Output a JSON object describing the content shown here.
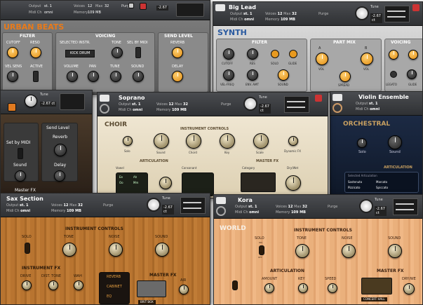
{
  "panels": {
    "urban": {
      "title": "URBAN BEATS",
      "sections": [
        "FILTER",
        "VOICING",
        "SEND LEVEL"
      ],
      "labels": [
        "CUTOFF",
        "RESO",
        "SELECTED INSTR.",
        "TONE",
        "SEL BY MIDI",
        "REVERB",
        "VEL SENS",
        "ACTIVE",
        "VOLUME",
        "PAN",
        "TUNE",
        "SOUND",
        "DELAY"
      ],
      "select": "KICK DRUM",
      "hdr": {
        "output": "Output",
        "output_val": "st. 1",
        "midi": "Midi Ch",
        "midi_val": "omni",
        "voices": "Voices",
        "voices_val": "12",
        "max": "Max",
        "max_val": "32",
        "memory": "Memory",
        "memory_val": "109 MB",
        "purge": "Purge",
        "tune_val": "-2.67"
      }
    },
    "synth": {
      "instrument": "Big Lead",
      "title": "SYNTH",
      "sections": [
        "FILTER",
        "PART MIX",
        "VOICING"
      ],
      "labels": [
        "CUTOFF",
        "RES",
        "SOLO",
        "GLIDE",
        "A",
        "B",
        "VOL",
        "VOL",
        "SPREAD",
        "VEL-FREQ",
        "ENV. AMT",
        "SOUND",
        "LEGATO",
        "GLIDE",
        "SPREAD"
      ],
      "hdr": {
        "output": "Output",
        "output_val": "st. 1",
        "midi": "Midi Ch",
        "midi_val": "omni",
        "voices": "Voices",
        "voices_val": "12",
        "max": "Max",
        "max_val": "32",
        "memory": "Memory",
        "memory_val": "109 MB",
        "purge": "Purge",
        "tune": "Tune",
        "tune_val": "-2.67 ct"
      }
    },
    "orange": {
      "sections": [
        "Send Level"
      ],
      "labels": [
        "Set by MIDI",
        "Reverb",
        "Sound",
        "Delay",
        "Master FX"
      ],
      "hdr": {
        "tune": "Tune",
        "tune_val": "-2.67 ct"
      }
    },
    "choir": {
      "instrument": "Soprano",
      "title": "CHOIR",
      "section": "INSTRUMENT CONTROLS",
      "knobs": [
        "Solo",
        "Sound",
        "Chord",
        "Key",
        "Scale",
        "Dynamic FX"
      ],
      "articulation": "ARTICULATION",
      "vowel": "Vowel",
      "consonant": "Consonant",
      "rows": [
        "Ee",
        "Oo",
        "Ah",
        "Mm"
      ],
      "masterfx": "MASTER FX",
      "category": "Category",
      "drywet": "Dry/Wet",
      "hdr": {
        "output": "Output",
        "output_val": "st. 1",
        "midi": "Midi Ch",
        "midi_val": "omni",
        "voices": "Voices",
        "voices_val": "12",
        "max": "Max",
        "max_val": "32",
        "memory": "Memory",
        "memory_val": "109 MB",
        "purge": "Purge",
        "tune": "Tune",
        "tune_val": "-2.67 ct"
      }
    },
    "violin": {
      "instrument": "Violin Ensemble",
      "title": "ORCHESTRAL",
      "knobs": [
        "Solo",
        "Sound"
      ],
      "articulation": "ARTICULATION",
      "selected": "Selected Articulation",
      "items": [
        "Sostenuto",
        "Pizzicato",
        "Marcato"
      ],
      "items2": [
        "Spiccato",
        "Sforzando",
        "Tremolo"
      ],
      "hdr": {
        "output": "Output",
        "output_val": "st. 1",
        "midi": "Midi Ch",
        "midi_val": "omni",
        "voices": "Voices",
        "voices_val": "12",
        "max": "Max",
        "max_val": "32",
        "memory": "Memory",
        "memory_val": "109 MB",
        "purge": "Purge",
        "tune": "Tune",
        "tune_val": "-2.67 ct"
      }
    },
    "sax": {
      "instrument": "Sax Section",
      "section": "INSTRUMENT CONTROLS",
      "knobs": [
        "SOLO",
        "TONE",
        "NOISE",
        "SOUND"
      ],
      "instfx": "INSTRUMENT FX",
      "fx": [
        "DRIVE",
        "DIST. TONE",
        "WAH"
      ],
      "opts": [
        "REVERB",
        "CABINET",
        "EQ"
      ],
      "masterfx": "MASTER FX",
      "preset": "BRIT BOX",
      "air": "AIR",
      "hdr": {
        "output": "Output",
        "output_val": "st. 1",
        "midi": "Midi Ch",
        "midi_val": "omni",
        "voices": "Voices",
        "voices_val": "12",
        "max": "Max",
        "max_val": "32",
        "memory": "Memory",
        "memory_val": "109 MB",
        "purge": "Purge",
        "tune": "Tune",
        "tune_val": "-2.67 ct"
      }
    },
    "kora": {
      "instrument": "Kora",
      "title": "WORLD",
      "section": "INSTRUMENT CONTROLS",
      "knobs": [
        "SOLO",
        "TONE",
        "NOISE",
        "SOUND"
      ],
      "on": "ON",
      "off": "OFF",
      "articulation": "ARTICULATION",
      "art": [
        "AMOUNT",
        "KEY",
        "SPEED"
      ],
      "masterfx": "MASTER FX",
      "preset": "CONCERT HALL",
      "drywet": "DRY/WE",
      "hdr": {
        "output": "Output",
        "output_val": "st. 1",
        "midi": "Midi Ch",
        "midi_val": "omni",
        "voices": "Voices",
        "voices_val": "12",
        "max": "Max",
        "max_val": "32",
        "memory": "Memory",
        "memory_val": "109 MB",
        "purge": "Purge",
        "tune": "Tune",
        "tune_val": "-2.67 ct"
      }
    }
  }
}
